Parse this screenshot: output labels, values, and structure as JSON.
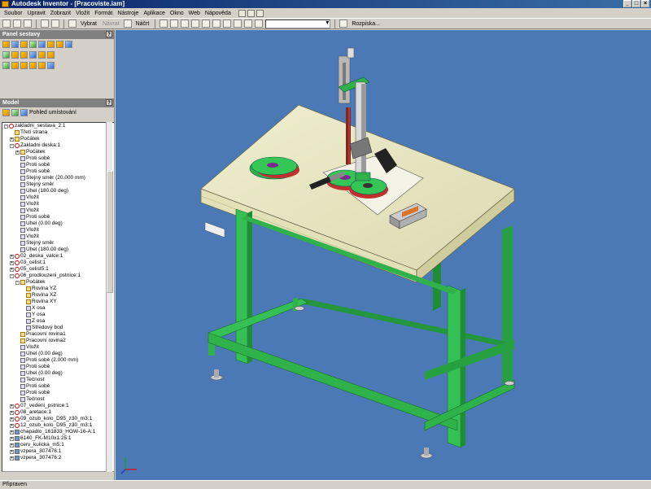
{
  "window": {
    "title": "Autodesk Inventor - [Pracoviste.iam]"
  },
  "menu": [
    "Soubor",
    "Upravit",
    "Zobrazit",
    "Vložit",
    "Formát",
    "Nástroje",
    "Aplikace",
    "Okno",
    "Web",
    "Nápověda"
  ],
  "toolbar": {
    "select_label": "Vybrat",
    "return_label": "Návrat",
    "sketch_label": "Náčrt",
    "layer_label": "Rozpiska..."
  },
  "panel": {
    "title": "Panel sestavy"
  },
  "model": {
    "title": "Model",
    "view_label": "Pohled umístování"
  },
  "tree": [
    {
      "d": 0,
      "t": "-",
      "i": "red",
      "label": "zakladni_sestava_2:1"
    },
    {
      "d": 1,
      "t": "",
      "i": "fold",
      "label": "Třetí strana"
    },
    {
      "d": 1,
      "t": "+",
      "i": "fold",
      "label": "Počátek"
    },
    {
      "d": 1,
      "t": "-",
      "i": "red",
      "label": "Zakladni deska:1"
    },
    {
      "d": 2,
      "t": "+",
      "i": "fold",
      "label": "Počátek"
    },
    {
      "d": 2,
      "t": "",
      "i": "con",
      "label": "Proti sobě"
    },
    {
      "d": 2,
      "t": "",
      "i": "con",
      "label": "Proti sobě"
    },
    {
      "d": 2,
      "t": "",
      "i": "con",
      "label": "Proti sobě"
    },
    {
      "d": 2,
      "t": "",
      "i": "con",
      "label": "Stejný směr (20.000 mm)"
    },
    {
      "d": 2,
      "t": "",
      "i": "con",
      "label": "Stejný směr"
    },
    {
      "d": 2,
      "t": "",
      "i": "con",
      "label": "Úhel (180.00 deg)"
    },
    {
      "d": 2,
      "t": "",
      "i": "con",
      "label": "Vložit"
    },
    {
      "d": 2,
      "t": "",
      "i": "con",
      "label": "Vložit"
    },
    {
      "d": 2,
      "t": "",
      "i": "con",
      "label": "Vložit"
    },
    {
      "d": 2,
      "t": "",
      "i": "con",
      "label": "Proti sobě"
    },
    {
      "d": 2,
      "t": "",
      "i": "con",
      "label": "Úhel (0.00 deg)"
    },
    {
      "d": 2,
      "t": "",
      "i": "con",
      "label": "Vložit"
    },
    {
      "d": 2,
      "t": "",
      "i": "con",
      "label": "Vložit"
    },
    {
      "d": 2,
      "t": "",
      "i": "con",
      "label": "Stejný směr"
    },
    {
      "d": 2,
      "t": "",
      "i": "con",
      "label": "Úhel (180.00 deg)"
    },
    {
      "d": 1,
      "t": "+",
      "i": "red",
      "label": "02_deska_valce:1"
    },
    {
      "d": 1,
      "t": "+",
      "i": "red",
      "label": "03_celist:1"
    },
    {
      "d": 1,
      "t": "+",
      "i": "red",
      "label": "05_celist5:1"
    },
    {
      "d": 1,
      "t": "-",
      "i": "red",
      "label": "06_prodlouzeni_pstnice:1"
    },
    {
      "d": 2,
      "t": "-",
      "i": "fold",
      "label": "Počátek"
    },
    {
      "d": 3,
      "t": "",
      "i": "fold",
      "label": "Rovina YZ"
    },
    {
      "d": 3,
      "t": "",
      "i": "fold",
      "label": "Rovina XZ"
    },
    {
      "d": 3,
      "t": "",
      "i": "fold",
      "label": "Rovina XY"
    },
    {
      "d": 3,
      "t": "",
      "i": "con",
      "label": "X osa"
    },
    {
      "d": 3,
      "t": "",
      "i": "con",
      "label": "Y osa"
    },
    {
      "d": 3,
      "t": "",
      "i": "con",
      "label": "Z osa"
    },
    {
      "d": 3,
      "t": "",
      "i": "con",
      "label": "Středový bod"
    },
    {
      "d": 2,
      "t": "",
      "i": "fold",
      "label": "Pracovní rovina1"
    },
    {
      "d": 2,
      "t": "",
      "i": "fold",
      "label": "Pracovní rovina2"
    },
    {
      "d": 2,
      "t": "",
      "i": "con",
      "label": "Vložit"
    },
    {
      "d": 2,
      "t": "",
      "i": "con",
      "label": "Úhel (0.00 deg)"
    },
    {
      "d": 2,
      "t": "",
      "i": "con",
      "label": "Proti sobě (2.000 mm)"
    },
    {
      "d": 2,
      "t": "",
      "i": "con",
      "label": "Proti sobě"
    },
    {
      "d": 2,
      "t": "",
      "i": "con",
      "label": "Úhel (0.00 deg)"
    },
    {
      "d": 2,
      "t": "",
      "i": "con",
      "label": "Tečnost"
    },
    {
      "d": 2,
      "t": "",
      "i": "con",
      "label": "Proti sobě"
    },
    {
      "d": 2,
      "t": "",
      "i": "con",
      "label": "Proti sobě"
    },
    {
      "d": 2,
      "t": "",
      "i": "con",
      "label": "Tečnost"
    },
    {
      "d": 1,
      "t": "+",
      "i": "red",
      "label": "07_vedeni_pstnice:1"
    },
    {
      "d": 1,
      "t": "+",
      "i": "red",
      "label": "08_aretace:1"
    },
    {
      "d": 1,
      "t": "+",
      "i": "red",
      "label": "09_ozub_kolo_D95_z30_m3:1"
    },
    {
      "d": 1,
      "t": "+",
      "i": "red",
      "label": "12_ozub_kolo_D95_z30_m3:1"
    },
    {
      "d": 1,
      "t": "+",
      "i": "blue",
      "label": "chapadlo_161833_HGW-16-A:1"
    },
    {
      "d": 1,
      "t": "+",
      "i": "blue",
      "label": "6140_FK-M10x1.25:1"
    },
    {
      "d": 1,
      "t": "+",
      "i": "blue",
      "label": "cerv_kulicka_m5:1"
    },
    {
      "d": 1,
      "t": "+",
      "i": "blue",
      "label": "vzpera_307476:1"
    },
    {
      "d": 1,
      "t": "+",
      "i": "blue",
      "label": "vzpera_307476:2"
    }
  ],
  "status": {
    "text": "Připraven"
  },
  "colors": {
    "viewport": "#4a79b5",
    "frame": "#2fb24a",
    "table_top": "#ecebc8"
  }
}
